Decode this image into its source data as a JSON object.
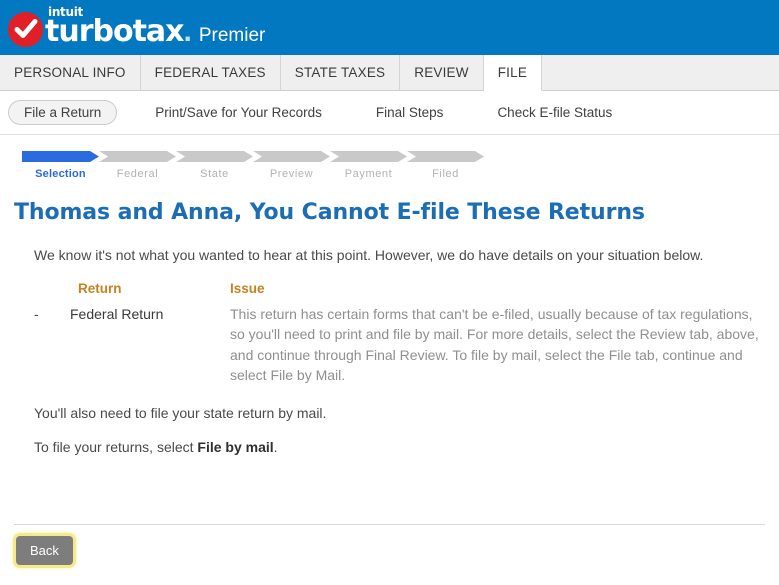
{
  "brand": {
    "intuit": "intuit",
    "product": "turbotax",
    "dot": ".",
    "edition": "Premier",
    "logo_icon": "check-circle-icon",
    "header_color": "#0278c1",
    "logo_color": "#e01f26"
  },
  "tabs": [
    {
      "label": "PERSONAL INFO",
      "active": false
    },
    {
      "label": "FEDERAL TAXES",
      "active": false
    },
    {
      "label": "STATE TAXES",
      "active": false
    },
    {
      "label": "REVIEW",
      "active": false
    },
    {
      "label": "FILE",
      "active": true
    }
  ],
  "subnav": [
    {
      "label": "File a Return",
      "selected": true
    },
    {
      "label": "Print/Save for Your Records",
      "selected": false
    },
    {
      "label": "Final Steps",
      "selected": false
    },
    {
      "label": "Check E-file Status",
      "selected": false
    }
  ],
  "stepper": {
    "current_color": "#2a6cdf",
    "inactive_color": "#c9c9c9",
    "steps": [
      {
        "label": "Selection",
        "current": true
      },
      {
        "label": "Federal",
        "current": false
      },
      {
        "label": "State",
        "current": false
      },
      {
        "label": "Preview",
        "current": false
      },
      {
        "label": "Payment",
        "current": false
      },
      {
        "label": "Filed",
        "current": false
      }
    ]
  },
  "main": {
    "title": "Thomas and Anna, You Cannot E-file These Returns",
    "title_color": "#1c6eb4",
    "intro": "We know it's not what you wanted to hear at this point. However, we do have details on your situation below.",
    "table": {
      "header_color": "#c5821f",
      "columns": [
        "Return",
        "Issue"
      ],
      "rows": [
        {
          "bullet": "-",
          "return": "Federal Return",
          "issue": "This return has certain forms that can't be e-filed, usually because of tax regulations, so you'll need to print and file by mail. For more details, select the Review tab, above, and continue through Final Review. To file by mail, select the File tab, continue and select File by Mail."
        }
      ]
    },
    "paragraph_state": "You'll also need to file your state return by mail.",
    "paragraph_action_prefix": "To file your returns, select ",
    "paragraph_action_bold": "File by mail",
    "paragraph_action_suffix": "."
  },
  "footer": {
    "back_label": "Back",
    "back_color": "#7d7d7d",
    "focus_ring_color": "#f5e98a"
  }
}
